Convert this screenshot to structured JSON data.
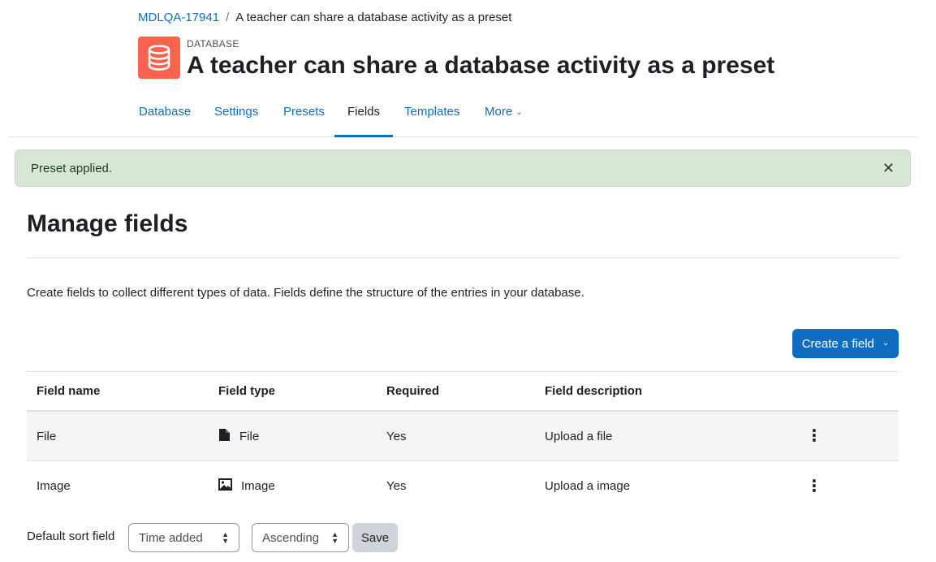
{
  "breadcrumb": {
    "course": "MDLQA-17941",
    "separator": "/",
    "current": "A teacher can share a database activity as a preset"
  },
  "header": {
    "activity_type": "DATABASE",
    "title": "A teacher can share a database activity as a preset",
    "icon": "database-icon",
    "icon_color": "#f7634d"
  },
  "nav": {
    "tabs": [
      {
        "label": "Database"
      },
      {
        "label": "Settings"
      },
      {
        "label": "Presets"
      },
      {
        "label": "Fields"
      },
      {
        "label": "Templates"
      },
      {
        "label": "More"
      }
    ],
    "active": "Fields"
  },
  "alert": {
    "message": "Preset applied.",
    "close_icon": "close-icon",
    "bg_color": "#d7e6d5"
  },
  "main": {
    "heading": "Manage fields",
    "intro": "Create fields to collect different types of data. Fields define the structure of the entries in your database.",
    "create_button": "Create a field"
  },
  "table": {
    "headers": [
      "Field name",
      "Field type",
      "Required",
      "Field description"
    ],
    "rows": [
      {
        "name": "File",
        "type": "File",
        "type_icon": "file-icon",
        "required": "Yes",
        "description": "Upload a file"
      },
      {
        "name": "Image",
        "type": "Image",
        "type_icon": "image-icon",
        "required": "Yes",
        "description": "Upload a image"
      }
    ]
  },
  "sort": {
    "label": "Default sort field",
    "field_value": "Time added",
    "order_value": "Ascending",
    "save_label": "Save"
  },
  "colors": {
    "accent": "#0f6cbf"
  }
}
